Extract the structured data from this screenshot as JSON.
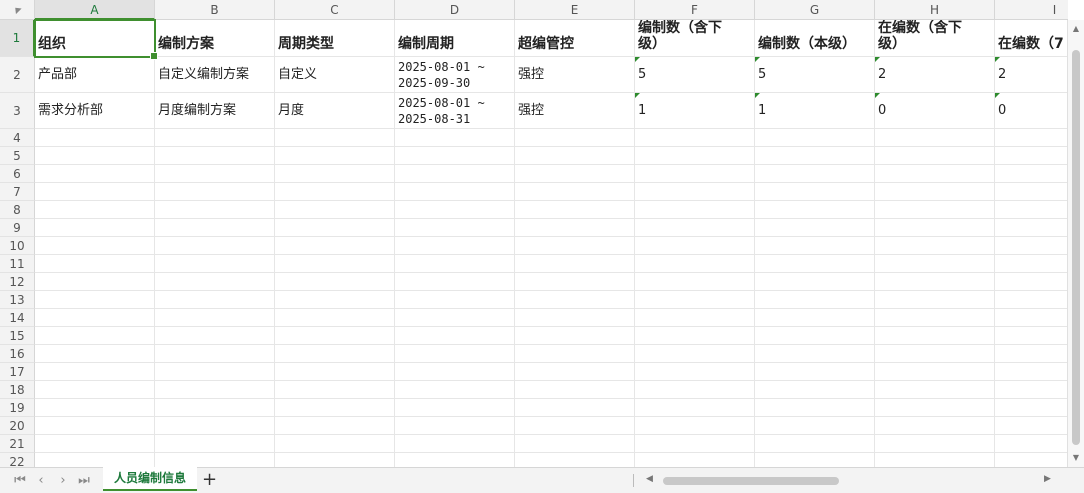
{
  "corner": {
    "icon": "select-all-triangle-icon"
  },
  "columns": [
    "A",
    "B",
    "C",
    "D",
    "E",
    "F",
    "G",
    "H",
    "I"
  ],
  "active_column": "A",
  "row_numbers": [
    "1",
    "2",
    "3",
    "4",
    "5",
    "6",
    "7",
    "8",
    "9",
    "10",
    "11",
    "12",
    "13",
    "14",
    "15",
    "16",
    "17",
    "18",
    "19",
    "20",
    "21",
    "22"
  ],
  "active_row": "1",
  "header_row": [
    "组织",
    "编制方案",
    "周期类型",
    "编制周期",
    "超编管控",
    "编制数（含下\n级）",
    "编制数（本级）",
    "在编数（含下\n级）",
    "在编数（ᅟ"
  ],
  "data_rows": [
    [
      "产品部",
      "自定义编制方案",
      "自定义",
      "2025-08-01 ~\n2025-09-30",
      "强控",
      "5",
      "5",
      "2",
      "2"
    ],
    [
      "需求分析部",
      "月度编制方案",
      "月度",
      "2025-08-01 ~\n2025-08-31",
      "强控",
      "1",
      "1",
      "0",
      "0"
    ]
  ],
  "header_last_cell_display": "在编数（7",
  "sheet_tabs": [
    {
      "label": "人员编制信息",
      "active": true
    }
  ],
  "tabbar": {
    "first_icon": "⏮",
    "prev_icon": "‹",
    "next_icon": "›",
    "last_icon": "⏭",
    "add_label": "+"
  },
  "colors": {
    "accent": "#3f8f2f",
    "tab_text": "#1e7a3c"
  }
}
